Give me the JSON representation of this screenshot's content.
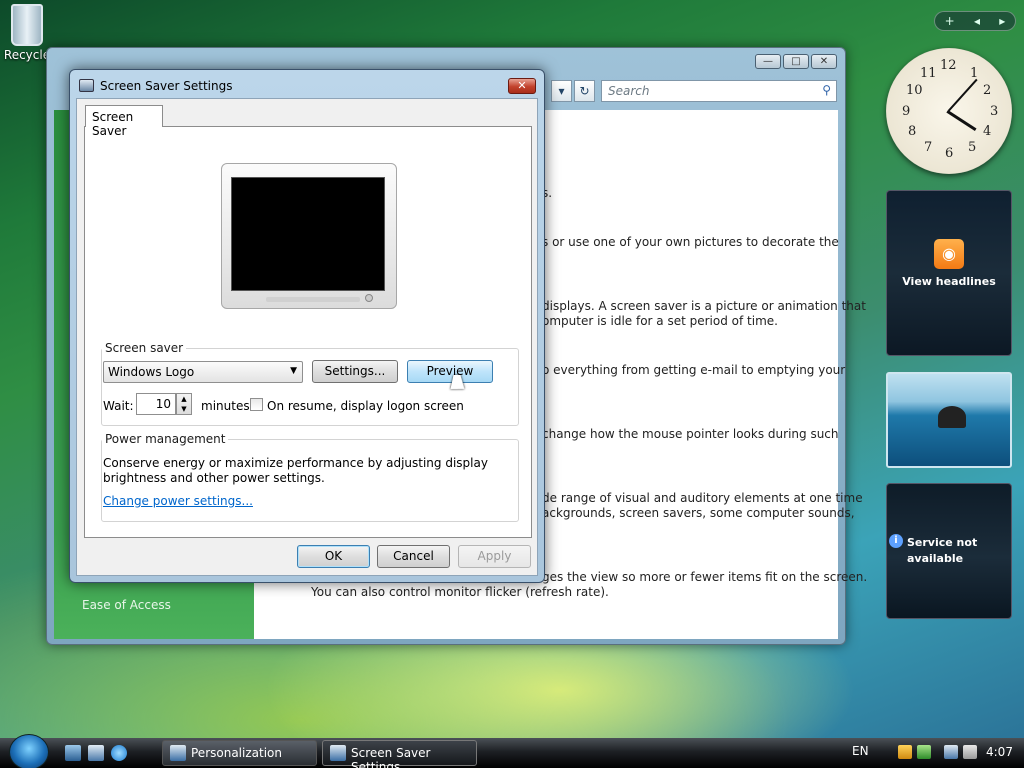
{
  "desktop": {
    "recycle_label": "Recycle"
  },
  "background_window": {
    "search_placeholder": "Search",
    "left_nav_item": "Ease of Access",
    "text_fragments": [
      "s.",
      "s or use one of your own pictures to decorate the",
      "displays. A screen saver is a picture or animation that",
      "omputer is idle for a set period of time.",
      "o everything from getting e-mail to emptying your",
      "change how the mouse pointer looks during such",
      "de range of visual and auditory elements at one time",
      "ackgrounds, screen savers, some computer sounds,",
      "ges the view so more or fewer items fit on the screen.",
      "You can also control monitor flicker (refresh rate)."
    ]
  },
  "dialog": {
    "title": "Screen Saver Settings",
    "tab_label": "Screen Saver",
    "screen_saver_group": "Screen saver",
    "screen_saver_selected": "Windows Logo",
    "settings_button": "Settings...",
    "preview_button": "Preview",
    "wait_label": "Wait:",
    "wait_value": "10",
    "minutes_label": "minutes",
    "resume_checkbox_label": "On resume, display logon screen",
    "resume_checked": false,
    "power_group": "Power management",
    "power_text_1": "Conserve energy or maximize performance by adjusting display",
    "power_text_2": "brightness and other power settings.",
    "power_link": "Change power settings...",
    "ok_button": "OK",
    "cancel_button": "Cancel",
    "apply_button": "Apply"
  },
  "gadgets": {
    "clock_numbers": [
      "12",
      "1",
      "2",
      "3",
      "4",
      "5",
      "6",
      "7",
      "8",
      "9",
      "10",
      "11"
    ],
    "feeds_label": "View headlines",
    "service_text": "Service not\navailable"
  },
  "taskbar": {
    "items": [
      {
        "label": "Personalization"
      },
      {
        "label": "Screen Saver Settings"
      }
    ],
    "language": "EN",
    "time": "4:07"
  },
  "colors": {
    "link": "#0066cc",
    "preview_hot": "#bfe4fb",
    "close_red": "#c2412c"
  }
}
